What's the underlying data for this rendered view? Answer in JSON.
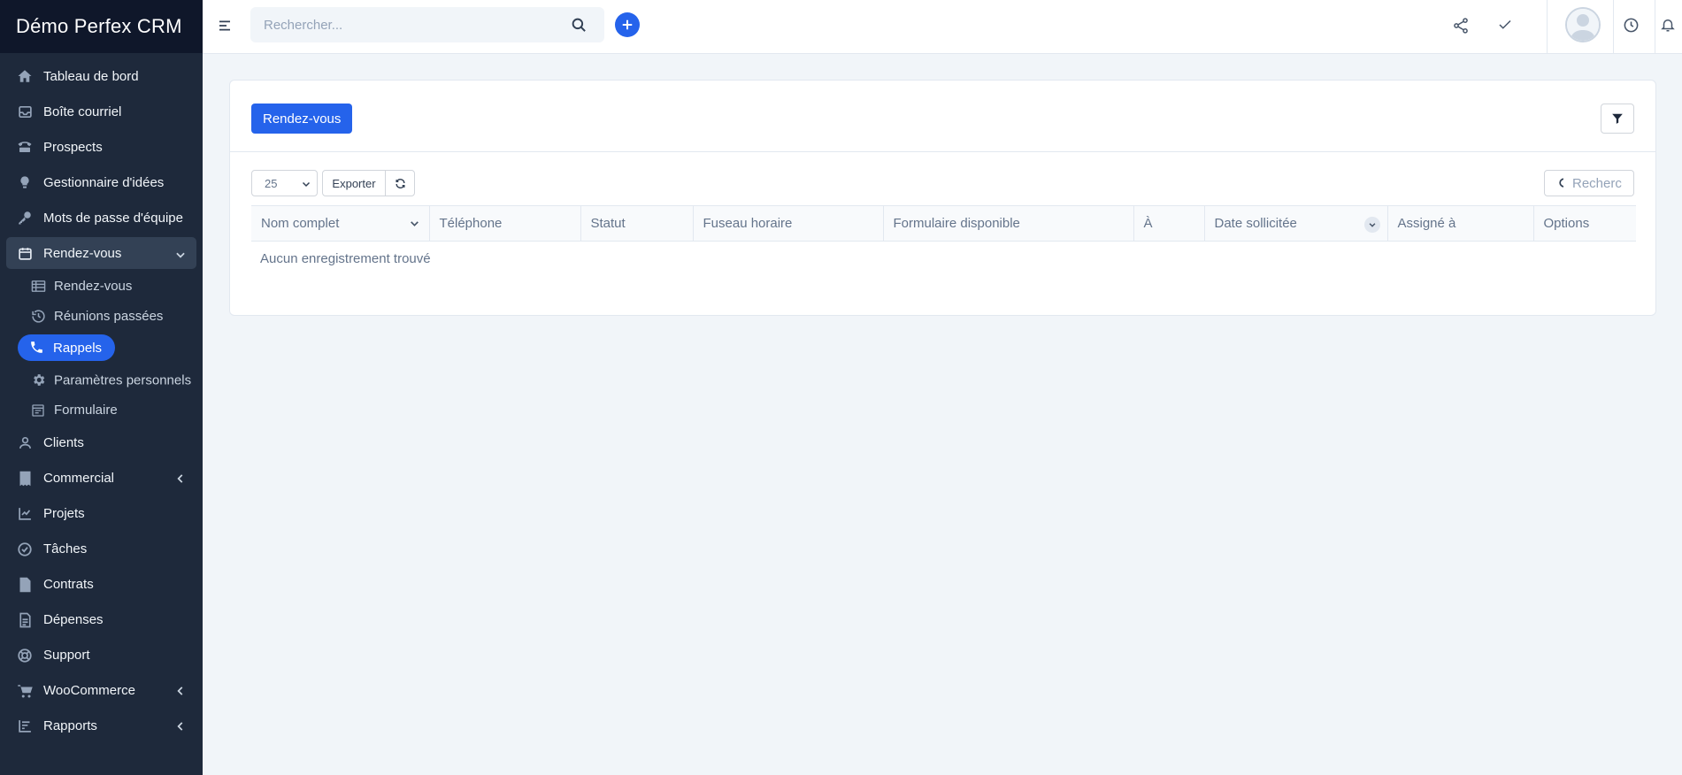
{
  "brand": {
    "title": "Démo Perfex CRM"
  },
  "sidebar": {
    "items": [
      {
        "label": "Tableau de bord",
        "icon": "home-icon"
      },
      {
        "label": "Boîte courriel",
        "icon": "inbox-icon"
      },
      {
        "label": "Prospects",
        "icon": "tty-icon"
      },
      {
        "label": "Gestionnaire d'idées",
        "icon": "lightbulb-icon"
      },
      {
        "label": "Mots de passe d'équipe",
        "icon": "key-icon"
      },
      {
        "label": "Rendez-vous",
        "icon": "calendar-icon"
      },
      {
        "label": "Clients",
        "icon": "user-icon"
      },
      {
        "label": "Commercial",
        "icon": "receipt-icon"
      },
      {
        "label": "Projets",
        "icon": "chart-icon"
      },
      {
        "label": "Tâches",
        "icon": "check-circle-icon"
      },
      {
        "label": "Contrats",
        "icon": "file-contract-icon"
      },
      {
        "label": "Dépenses",
        "icon": "file-invoice-icon"
      },
      {
        "label": "Support",
        "icon": "life-ring-icon"
      },
      {
        "label": "WooCommerce",
        "icon": "cart-icon"
      },
      {
        "label": "Rapports",
        "icon": "bar-chart-icon"
      }
    ],
    "submenu": {
      "appointments": "Rendez-vous",
      "past_meetings": "Réunions passées",
      "callbacks": "Rappels",
      "personal_settings": "Paramètres personnels",
      "form": "Formulaire"
    }
  },
  "topbar": {
    "search_placeholder": "Rechercher..."
  },
  "panel": {
    "primary_button": "Rendez-vous",
    "page_length": "25",
    "export_label": "Exporter",
    "table_search_placeholder": "Recherc",
    "columns": [
      "Nom complet",
      "Téléphone",
      "Statut",
      "Fuseau horaire",
      "Formulaire disponible",
      "À",
      "Date sollicitée",
      "Assigné à",
      "Options"
    ],
    "empty_message": "Aucun enregistrement trouvé"
  },
  "colors": {
    "sidebar": "#1e293b",
    "brand_bar": "#0f172a",
    "accent": "#2563eb",
    "page_bg": "#f1f5f9"
  }
}
